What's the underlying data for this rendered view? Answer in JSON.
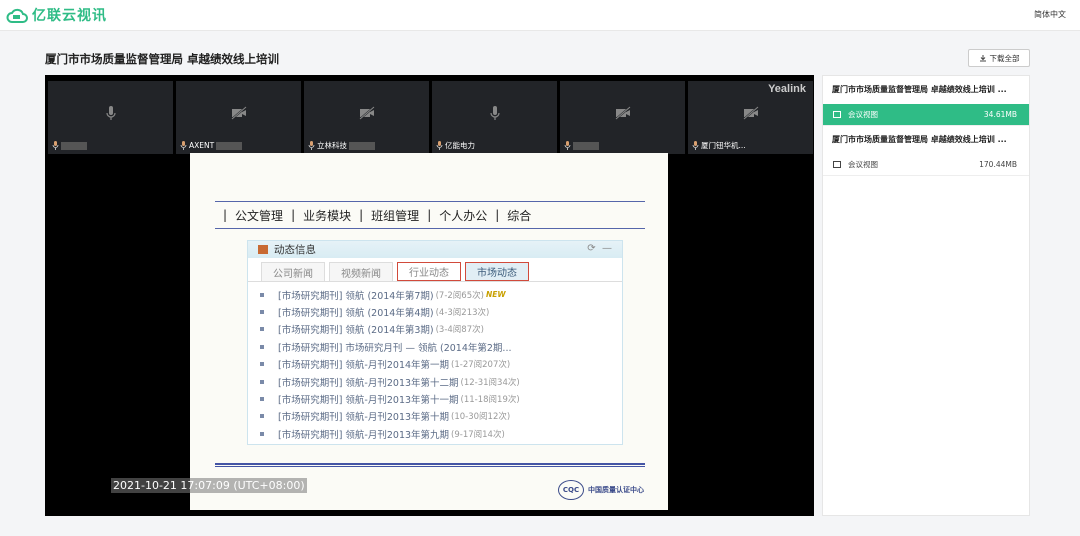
{
  "app": {
    "name": "亿联云视讯",
    "language": "简体中文"
  },
  "page": {
    "title": "厦门市市场质量监督管理局 卓越绩效线上培训",
    "download_all": "下载全部"
  },
  "player": {
    "brand": "Yealink",
    "timestamp": "2021-10-21 17:07:09 (UTC+08:00)",
    "tiles": [
      {
        "icon": "mic-icon",
        "label": ""
      },
      {
        "icon": "camera-off-icon",
        "label": "AXENT"
      },
      {
        "icon": "camera-off-icon",
        "label": "立林科技"
      },
      {
        "icon": "mic-icon",
        "label": "亿能电力"
      },
      {
        "icon": "camera-off-icon",
        "label": ""
      },
      {
        "icon": "camera-off-icon",
        "label": "厦门钮华机..."
      }
    ]
  },
  "slide": {
    "menu": [
      "公文管理",
      "业务模块",
      "班组管理",
      "个人办公",
      "综合"
    ],
    "panel_title": "动态信息",
    "tabs": [
      "公司新闻",
      "视频新闻",
      "行业动态",
      "市场动态"
    ],
    "rows": [
      {
        "text": "[市场研究期刊] 领航 (2014年第7期)",
        "count": "(7-2阅65次)"
      },
      {
        "text": "[市场研究期刊] 领航 (2014年第4期)",
        "count": "(4-3阅213次)"
      },
      {
        "text": "[市场研究期刊] 领航 (2014年第3期)",
        "count": "(3-4阅87次)"
      },
      {
        "text": "[市场研究期刊] 市场研究月刊 — 领航 (2014年第2期...",
        "count": ""
      },
      {
        "text": "[市场研究期刊] 领航-月刊2014年第一期",
        "count": "(1-27阅207次)"
      },
      {
        "text": "[市场研究期刊] 领航-月刊2013年第十二期",
        "count": "(12-31阅34次)"
      },
      {
        "text": "[市场研究期刊] 领航-月刊2013年第十一期",
        "count": "(11-18阅19次)"
      },
      {
        "text": "[市场研究期刊] 领航-月刊2013年第十期",
        "count": "(10-30阅12次)"
      },
      {
        "text": "[市场研究期刊] 领航-月刊2013年第九期",
        "count": "(9-17阅14次)"
      }
    ],
    "new_badge": "NEW",
    "cqc_seal": "CQC",
    "cqc_name": "中国质量认证中心"
  },
  "recordings": [
    {
      "title": "厦门市市场质量监督管理局 卓越绩效线上培训 ...",
      "item_label": "会议视图",
      "size": "34.61MB",
      "selected": true
    },
    {
      "title": "厦门市市场质量监督管理局 卓越绩效线上培训 ...",
      "item_label": "会议视图",
      "size": "170.44MB",
      "selected": false
    }
  ]
}
